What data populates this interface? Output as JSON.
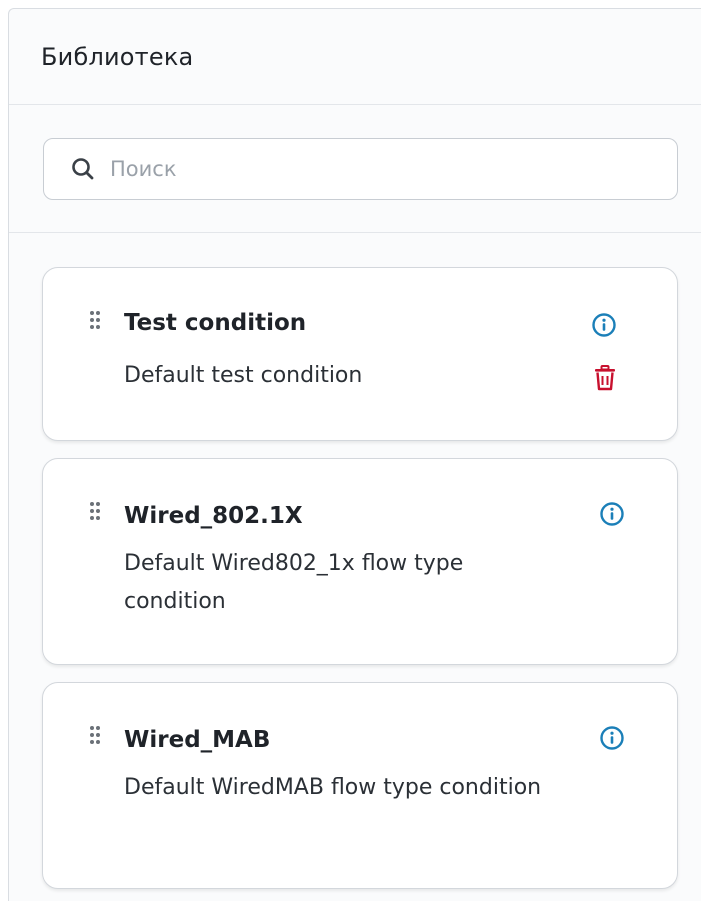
{
  "panel": {
    "title": "Библиотека"
  },
  "search": {
    "placeholder": "Поиск",
    "value": ""
  },
  "conditions": [
    {
      "title": "Test condition",
      "description": "Default test condition",
      "has_delete": true
    },
    {
      "title": "Wired_802.1X",
      "description": "Default Wired802_1x flow type condition",
      "has_delete": false
    },
    {
      "title": "Wired_MAB",
      "description": "Default WiredMAB flow type condition",
      "has_delete": false
    }
  ],
  "colors": {
    "info_icon": "#1b7fb8",
    "delete_icon": "#c8102e",
    "drag_handle": "#6b7178"
  },
  "icons": {
    "search": "search-icon",
    "drag": "drag-handle-icon",
    "info": "info-icon",
    "delete": "trash-icon"
  }
}
